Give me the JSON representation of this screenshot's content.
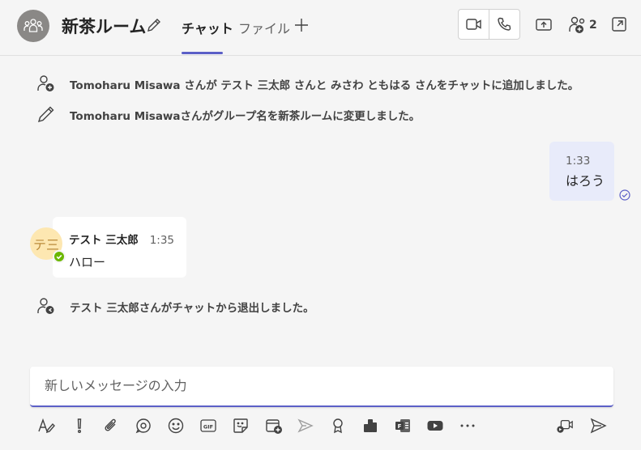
{
  "header": {
    "title": "新茶ルーム",
    "tabs": [
      {
        "label": "チャット",
        "active": true
      },
      {
        "label": "ファイル",
        "active": false
      }
    ],
    "participant_count": "2",
    "accent_color": "#5b5fc7"
  },
  "messages": {
    "system": [
      {
        "icon": "person-add-icon",
        "text": "Tomoharu Misawa さんが テスト 三太郎 さんと みさわ ともはる さんをチャットに追加しました。"
      },
      {
        "icon": "pencil-icon",
        "text": "Tomoharu Misawaさんがグループ名を新茶ルームに変更しました。"
      },
      {
        "icon": "person-leave-icon",
        "text": "テスト 三太郎さんがチャットから退出しました。"
      }
    ],
    "mine": {
      "time": "1:33",
      "text": "はろう",
      "status": "read"
    },
    "theirs": {
      "avatar_initials": "テ三",
      "sender": "テスト 三太郎",
      "time": "1:35",
      "text": "ハロー",
      "presence": "available"
    }
  },
  "composer": {
    "placeholder": "新しいメッセージの入力"
  },
  "toolbar": {
    "icons": [
      "format-icon",
      "important-icon",
      "attach-icon",
      "loop-icon",
      "emoji-icon",
      "gif-icon",
      "sticker-icon",
      "schedule-meeting-icon",
      "stream-icon",
      "praise-icon",
      "approvals-icon",
      "forms-icon",
      "youtube-icon",
      "more-options-icon",
      "video-clip-icon",
      "send-icon"
    ]
  }
}
